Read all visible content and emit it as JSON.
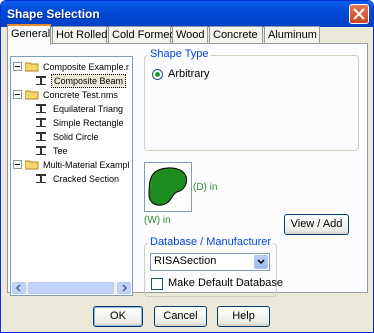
{
  "window": {
    "title": "Shape Selection"
  },
  "tabs": [
    "General",
    "Hot Rolled",
    "Cold Formed",
    "Wood",
    "Concrete",
    "Aluminum"
  ],
  "tree": {
    "items": [
      {
        "label": "Composite Example.r",
        "level": 0,
        "type": "folder",
        "expanded": true
      },
      {
        "label": "Composite Beam",
        "level": 1,
        "type": "shape",
        "selected": true
      },
      {
        "label": "Concrete Test.nms",
        "level": 0,
        "type": "folder",
        "expanded": true
      },
      {
        "label": "Equilateral Triang",
        "level": 1,
        "type": "shape"
      },
      {
        "label": "Simple Rectangle",
        "level": 1,
        "type": "shape"
      },
      {
        "label": "Solid Circle",
        "level": 1,
        "type": "shape"
      },
      {
        "label": "Tee",
        "level": 1,
        "type": "shape"
      },
      {
        "label": "Multi-Material Exampl",
        "level": 0,
        "type": "folder",
        "expanded": true
      },
      {
        "label": "Cracked Section",
        "level": 1,
        "type": "shape"
      }
    ]
  },
  "shape_type": {
    "title": "Shape Type",
    "option": "Arbitrary",
    "selected": true
  },
  "preview": {
    "depth_label": "(D) in",
    "width_label": "(W) in",
    "shape_color": "#1e8c1e"
  },
  "buttons": {
    "view_add": "View / Add",
    "ok": "OK",
    "cancel": "Cancel",
    "help": "Help"
  },
  "database": {
    "title": "Database / Manufacturer",
    "value": "RISASection",
    "make_default_label": "Make Default Database",
    "make_default_checked": false
  }
}
